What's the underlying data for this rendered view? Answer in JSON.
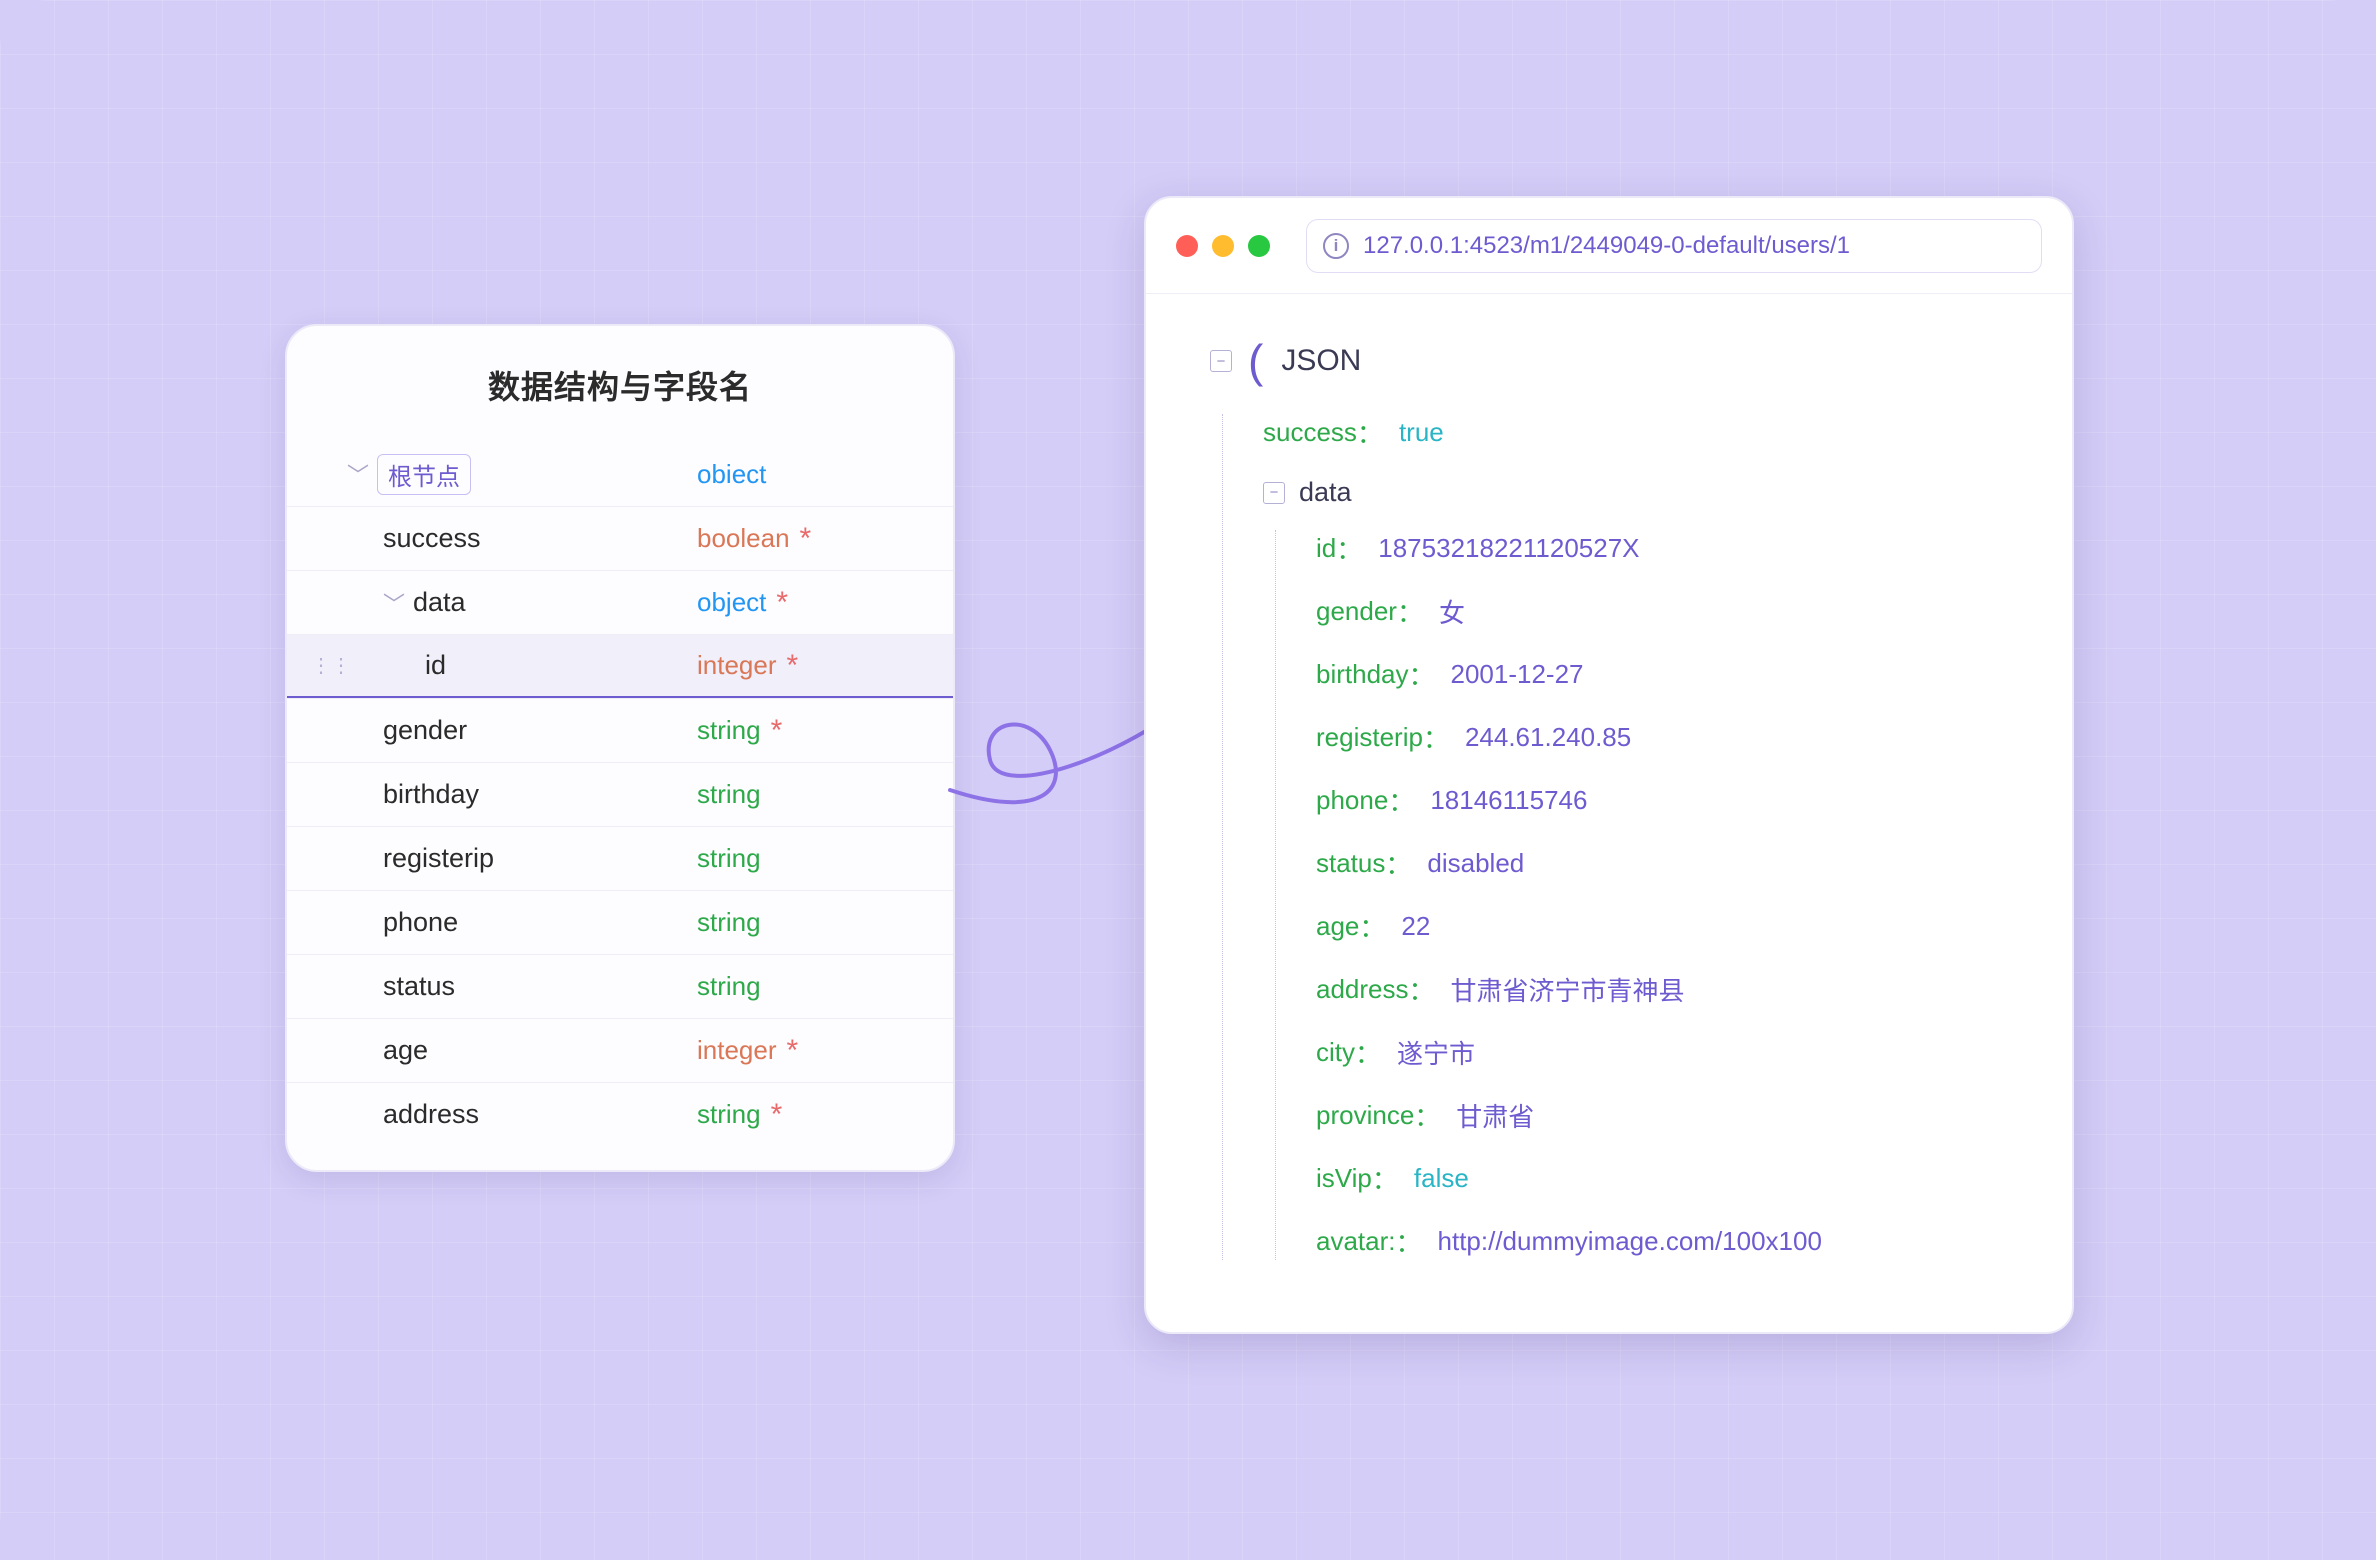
{
  "schema": {
    "title": "数据结构与字段名",
    "root_label": "根节点",
    "rows": [
      {
        "name": "根",
        "type": "obiect",
        "typeClass": "type-blue",
        "req": false,
        "indent": 0,
        "hasChevron": true,
        "isRootBadge": true,
        "active": false
      },
      {
        "name": "success",
        "type": "boolean",
        "typeClass": "type-orange",
        "req": true,
        "indent": 1,
        "hasChevron": false,
        "isRootBadge": false,
        "active": false
      },
      {
        "name": "data",
        "type": "object",
        "typeClass": "type-blue",
        "req": true,
        "indent": 1,
        "hasChevron": true,
        "isRootBadge": false,
        "active": false
      },
      {
        "name": "id",
        "type": "integer",
        "typeClass": "type-orange",
        "req": true,
        "indent": 2,
        "hasChevron": false,
        "isRootBadge": false,
        "active": true
      },
      {
        "name": "gender",
        "type": "string",
        "typeClass": "type-green",
        "req": true,
        "indent": 1,
        "hasChevron": false,
        "isRootBadge": false,
        "active": false
      },
      {
        "name": "birthday",
        "type": "string",
        "typeClass": "type-green",
        "req": false,
        "indent": 1,
        "hasChevron": false,
        "isRootBadge": false,
        "active": false
      },
      {
        "name": "registerip",
        "type": "string",
        "typeClass": "type-green",
        "req": false,
        "indent": 1,
        "hasChevron": false,
        "isRootBadge": false,
        "active": false
      },
      {
        "name": "phone",
        "type": "string",
        "typeClass": "type-green",
        "req": false,
        "indent": 1,
        "hasChevron": false,
        "isRootBadge": false,
        "active": false
      },
      {
        "name": "status",
        "type": "string",
        "typeClass": "type-green",
        "req": false,
        "indent": 1,
        "hasChevron": false,
        "isRootBadge": false,
        "active": false
      },
      {
        "name": "age",
        "type": "integer",
        "typeClass": "type-orange",
        "req": true,
        "indent": 1,
        "hasChevron": false,
        "isRootBadge": false,
        "active": false
      },
      {
        "name": "address",
        "type": "string",
        "typeClass": "type-green",
        "req": true,
        "indent": 1,
        "hasChevron": false,
        "isRootBadge": false,
        "active": false
      }
    ]
  },
  "browser": {
    "url": "127.0.0.1:4523/m1/2449049-0-default/users/1",
    "traffic_colors": [
      "#ff5f57",
      "#febc2e",
      "#28c840"
    ],
    "json_root_label": "JSON",
    "top_level": [
      {
        "key": "success",
        "val": "true",
        "valClass": "json-val-bool"
      }
    ],
    "data_label": "data",
    "data_fields": [
      {
        "key": "id",
        "val": "18753218221120527X"
      },
      {
        "key": "gender",
        "val": "女"
      },
      {
        "key": "birthday",
        "val": "2001-12-27"
      },
      {
        "key": "registerip",
        "val": "244.61.240.85"
      },
      {
        "key": "phone",
        "val": "18146115746"
      },
      {
        "key": "status",
        "val": "disabled"
      },
      {
        "key": "age",
        "val": "22"
      },
      {
        "key": "address",
        "val": "甘肃省济宁市青神县"
      },
      {
        "key": "city",
        "val": "遂宁市"
      },
      {
        "key": "province",
        "val": "甘肃省"
      },
      {
        "key": "isVip",
        "val": "false",
        "valClass": "json-val-bool"
      },
      {
        "key": "avatar:",
        "val": "http://dummyimage.com/100x100"
      }
    ]
  }
}
